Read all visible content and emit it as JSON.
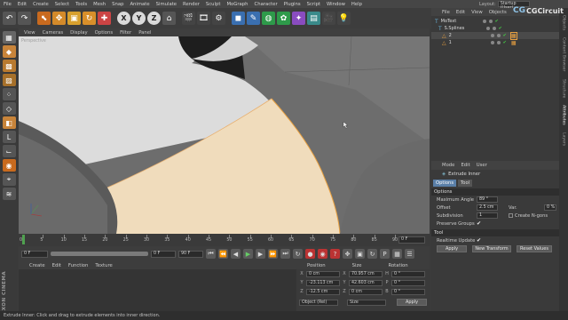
{
  "menu": [
    "File",
    "Edit",
    "Create",
    "Select",
    "Tools",
    "Mesh",
    "Snap",
    "Animate",
    "Simulate",
    "Render",
    "Sculpt",
    "MoGraph",
    "Character",
    "Plugins",
    "Script",
    "Window",
    "Help"
  ],
  "layout": {
    "label": "Layout:",
    "value": "Startup (User)"
  },
  "brand": {
    "logo_text": "CGCircuit",
    "side_text": "MAXON CINEMA 4D"
  },
  "toolbar": {
    "axis_x": "X",
    "axis_y": "Y",
    "axis_z": "Z"
  },
  "viewport": {
    "menu": [
      "View",
      "Cameras",
      "Display",
      "Options",
      "Filter",
      "Panel"
    ],
    "label": "Perspective"
  },
  "timeline": {
    "ticks": [
      "0",
      "5",
      "10",
      "15",
      "20",
      "25",
      "30",
      "35",
      "40",
      "45",
      "50",
      "55",
      "60",
      "65",
      "70",
      "75",
      "80",
      "85",
      "90"
    ],
    "end_field": "0 F"
  },
  "transport": {
    "start": "0 F",
    "current": "0 F",
    "end": "90 F",
    "end2": "90 F"
  },
  "material": {
    "menu": [
      "Create",
      "Edit",
      "Function",
      "Texture"
    ]
  },
  "coords": {
    "headers": [
      "Position",
      "Size",
      "Rotation"
    ],
    "rows": [
      {
        "pl": "X",
        "pv": "0 cm",
        "sv": "70.957 cm",
        "rl": "H",
        "rv": "0 °"
      },
      {
        "pl": "Y",
        "pv": "-23.113 cm",
        "sv": "42.603 cm",
        "rl": "P",
        "rv": "0 °"
      },
      {
        "pl": "Z",
        "pv": "-12.5 cm",
        "sv": "0 cm",
        "rl": "B",
        "rv": "0 °"
      }
    ],
    "mode": "Object (Rel)",
    "size_mode": "Size",
    "apply": "Apply"
  },
  "objects": {
    "menu": [
      "File",
      "Edit",
      "View",
      "Objects"
    ],
    "items": [
      "MoText",
      "S.Splines",
      "2",
      "1"
    ]
  },
  "attributes": {
    "menu": [
      "Mode",
      "Edit",
      "User"
    ],
    "title": "Extrude Inner",
    "tabs": [
      "Options",
      "Tool"
    ],
    "options_section": "Options",
    "max_angle_label": "Maximum Angle",
    "max_angle_value": "89 °",
    "offset_label": "Offset",
    "offset_value": "2.5 cm",
    "var_label": "Var.",
    "var_value": "0 %",
    "subdiv_label": "Subdivision",
    "subdiv_value": "1",
    "create_ngons": "Create N-gons",
    "preserve_groups": "Preserve Groups",
    "tool_section": "Tool",
    "realtime_update": "Realtime Update",
    "apply": "Apply",
    "new_transform": "New Transform",
    "reset_values": "Reset Values"
  },
  "side_tabs": [
    "Objects",
    "Content Browser",
    "Structure",
    "Attributes",
    "Layers"
  ],
  "status": "Extrude Inner: Click and drag to extrude elements into inner direction.",
  "colors": {
    "accent": "#e8a040",
    "selection": "#f0dcbc",
    "ui_bg": "#3b3b3b"
  }
}
